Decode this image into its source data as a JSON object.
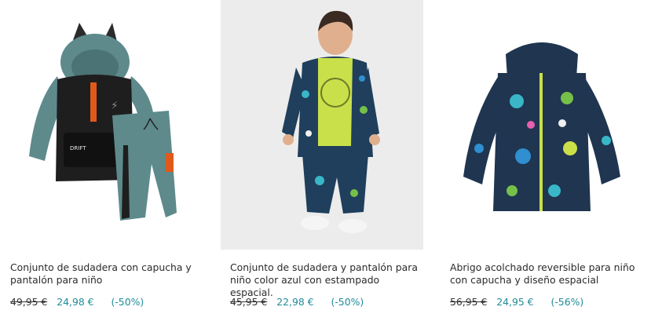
{
  "products": [
    {
      "image_alt": "conjunto-sudadera-capucha",
      "title": "Conjunto de sudadera con capucha y pantalón para niño",
      "old_price": "49,95 €",
      "new_price": "24,98 €",
      "discount": "(-50%)"
    },
    {
      "image_alt": "conjunto-estampado-espacial",
      "title": "Conjunto de sudadera y pantalón para niño color azul con estampado espacial.",
      "old_price": "45,95 €",
      "new_price": "22,98 €",
      "discount": "(-50%)"
    },
    {
      "image_alt": "abrigo-acolchado-reversible",
      "title": "Abrigo acolchado reversible para niño con capucha y diseño espacial",
      "old_price": "56,95 €",
      "new_price": "24,95 €",
      "discount": "(-56%)"
    }
  ],
  "colors": {
    "price_accent": "#1e8c99",
    "product2_bg": "#ececec"
  }
}
